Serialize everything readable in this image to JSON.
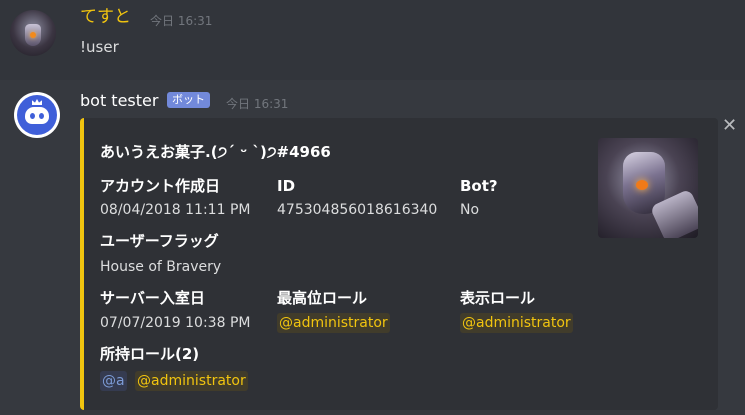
{
  "message1": {
    "username": "てすと",
    "timestamp": "今日 16:31",
    "content": "!user"
  },
  "message2": {
    "username": "bot tester",
    "badge": "ボット",
    "timestamp": "今日 16:31"
  },
  "embed": {
    "accent_color": "#f1c40f",
    "title": "あいうえお菓子.(੭ˊ ᵕ ˋ)੭#4966",
    "fields": {
      "account_created": {
        "name": "アカウント作成日",
        "value": "08/04/2018 11:11 PM"
      },
      "id": {
        "name": "ID",
        "value": "475304856018616340"
      },
      "bot": {
        "name": "Bot?",
        "value": "No"
      },
      "user_flags": {
        "name": "ユーザーフラッグ",
        "value": "House of Bravery"
      },
      "server_join": {
        "name": "サーバー入室日",
        "value": "07/07/2019 10:38 PM"
      },
      "top_role": {
        "name": "最高位ロール",
        "value": "@administrator"
      },
      "display_role": {
        "name": "表示ロール",
        "value": "@administrator"
      },
      "roles": {
        "name": "所持ロール(2)",
        "values": [
          "@a",
          "@administrator"
        ]
      }
    },
    "close_icon": "close-icon"
  },
  "colors": {
    "background": "#36393f",
    "embed_bg": "#2f3136",
    "username1": "#f1c40f",
    "badge": "#7289da",
    "mention": "#f1c40f"
  }
}
